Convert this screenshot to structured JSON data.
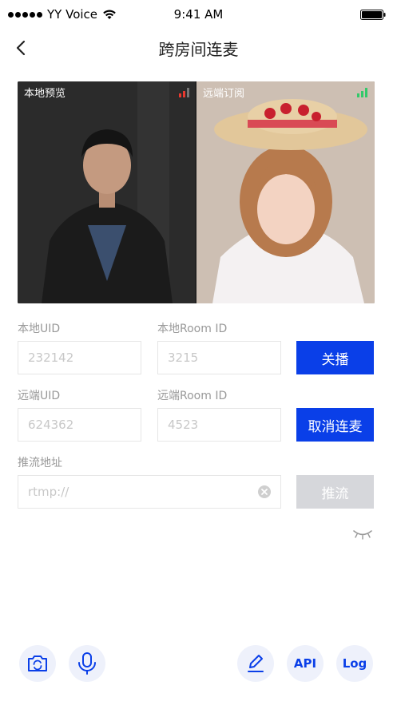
{
  "status_bar": {
    "carrier": "YY Voice",
    "time": "9:41 AM"
  },
  "nav": {
    "title": "跨房间连麦"
  },
  "video": {
    "local_label": "本地预览",
    "remote_label": "远端订阅",
    "local_signal_color": "#e8392f",
    "remote_signal_color": "#33c96a"
  },
  "form": {
    "local_uid_label": "本地UID",
    "local_uid_value": "232142",
    "local_room_label": "本地Room ID",
    "local_room_value": "3215",
    "stop_broadcast_button": "关播",
    "remote_uid_label": "远端UID",
    "remote_uid_value": "624362",
    "remote_room_label": "远端Room ID",
    "remote_room_value": "4523",
    "cancel_link_button": "取消连麦",
    "push_url_label": "推流地址",
    "push_url_placeholder": "rtmp://",
    "push_button": "推流"
  },
  "toolbar": {
    "api_label": "API",
    "log_label": "Log"
  },
  "colors": {
    "primary": "#0a3fe8",
    "disabled": "#d6d7db",
    "tool_bg": "#eef1fb"
  }
}
